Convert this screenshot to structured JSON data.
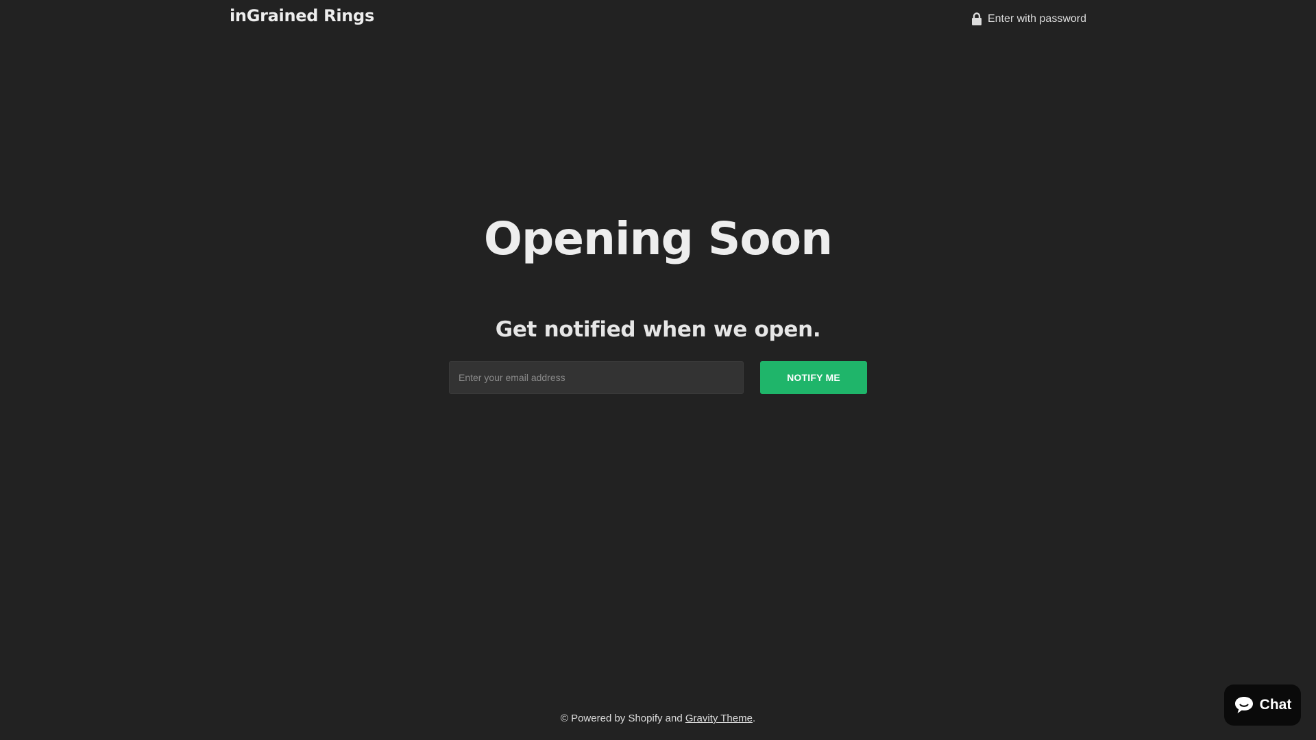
{
  "header": {
    "logo_text": "inGrained Rings",
    "password_link_text": "Enter with password",
    "password_icon": "lock-icon"
  },
  "main": {
    "headline": "Opening Soon",
    "subheadline": "Get notified when we open.",
    "email_input": {
      "value": "",
      "placeholder": "Enter your email address"
    },
    "notify_button_label": "NOTIFY ME"
  },
  "footer": {
    "prefix": "© Powered by Shopify and ",
    "theme_link_text": "Gravity Theme",
    "suffix": "."
  },
  "chat_widget": {
    "label": "Chat",
    "icon": "chat-bubble-icon"
  },
  "colors": {
    "background": "#222222",
    "accent": "#1fb56a",
    "text": "#e6e6e6",
    "input_background": "#333333",
    "chat_background": "#0a0a0a"
  }
}
